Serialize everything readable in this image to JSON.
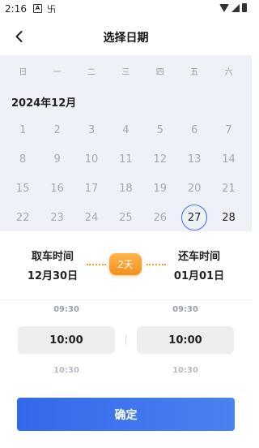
{
  "status_bar": {
    "time": "2:16",
    "icon1": "A",
    "icon2": "卐"
  },
  "header": {
    "title": "选择日期"
  },
  "calendar": {
    "weekdays": [
      "日",
      "一",
      "二",
      "三",
      "四",
      "五",
      "六"
    ],
    "month_title": "2024年12月",
    "days": [
      {
        "label": "1",
        "state": "disabled"
      },
      {
        "label": "2",
        "state": "disabled"
      },
      {
        "label": "3",
        "state": "disabled"
      },
      {
        "label": "4",
        "state": "disabled"
      },
      {
        "label": "5",
        "state": "disabled"
      },
      {
        "label": "6",
        "state": "disabled"
      },
      {
        "label": "7",
        "state": "disabled"
      },
      {
        "label": "8",
        "state": "disabled"
      },
      {
        "label": "9",
        "state": "disabled"
      },
      {
        "label": "10",
        "state": "disabled"
      },
      {
        "label": "11",
        "state": "disabled"
      },
      {
        "label": "12",
        "state": "disabled"
      },
      {
        "label": "13",
        "state": "disabled"
      },
      {
        "label": "14",
        "state": "disabled"
      },
      {
        "label": "15",
        "state": "disabled"
      },
      {
        "label": "16",
        "state": "disabled"
      },
      {
        "label": "17",
        "state": "disabled"
      },
      {
        "label": "18",
        "state": "disabled"
      },
      {
        "label": "19",
        "state": "disabled"
      },
      {
        "label": "20",
        "state": "disabled"
      },
      {
        "label": "21",
        "state": "disabled"
      },
      {
        "label": "22",
        "state": "disabled"
      },
      {
        "label": "23",
        "state": "disabled"
      },
      {
        "label": "24",
        "state": "disabled"
      },
      {
        "label": "25",
        "state": "disabled"
      },
      {
        "label": "26",
        "state": "disabled"
      },
      {
        "label": "27",
        "state": "today"
      },
      {
        "label": "28",
        "state": "active"
      }
    ]
  },
  "summary": {
    "pickup_label": "取车时间",
    "pickup_date": "12月30日",
    "return_label": "还车时间",
    "return_date": "01月01日",
    "days_badge": "2天"
  },
  "pickup_time": {
    "above": "09:30",
    "selected": "10:00",
    "below": "10:30"
  },
  "return_time": {
    "above": "09:30",
    "selected": "10:00",
    "below": "10:30"
  },
  "confirm_label": "确定",
  "colors": {
    "accent": "#3468ec",
    "badge": "#f48f1c",
    "calendar_bg": "#eef1f8"
  }
}
